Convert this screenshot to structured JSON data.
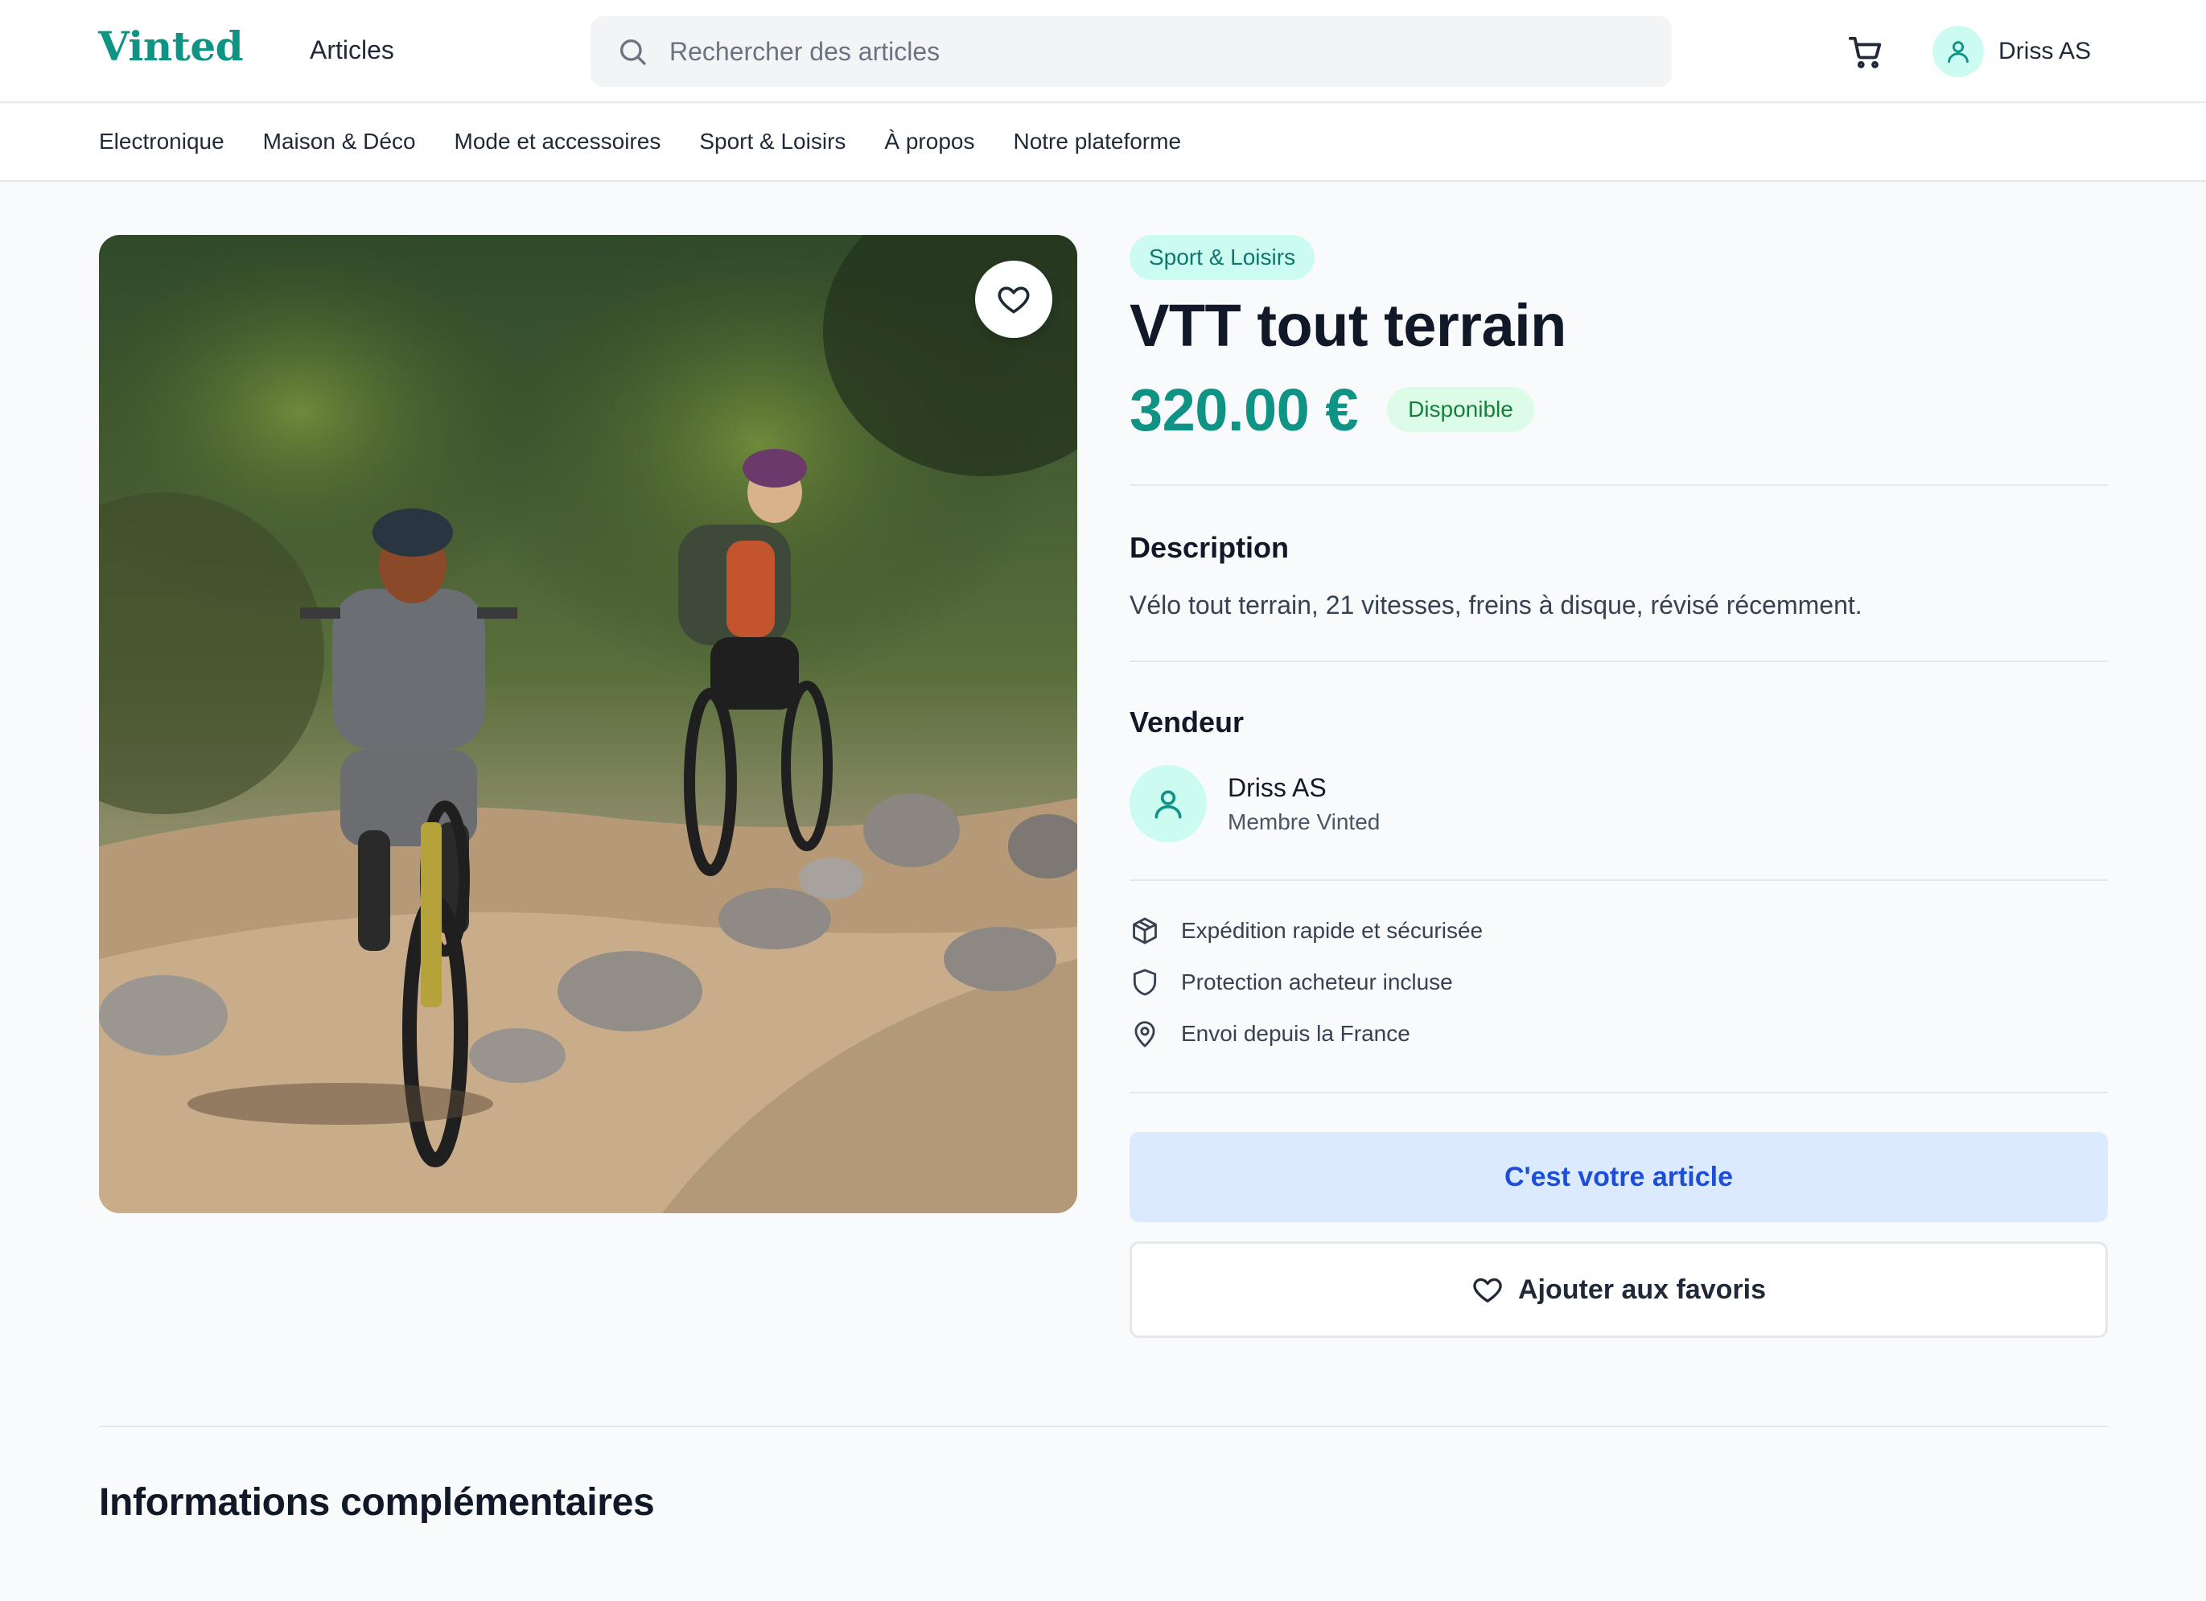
{
  "header": {
    "logo": "Vinted",
    "nav_articles": "Articles",
    "search_placeholder": "Rechercher des articles",
    "user_name": "Driss AS",
    "icons": {
      "search": "search-icon",
      "cart": "cart-icon",
      "user": "user-icon"
    }
  },
  "categories": [
    "Electronique",
    "Maison & Déco",
    "Mode et accessoires",
    "Sport & Loisirs",
    "À propos",
    "Notre plateforme"
  ],
  "product": {
    "category": "Sport & Loisirs",
    "title": "VTT tout terrain",
    "price": "320.00 €",
    "status": "Disponible",
    "description_heading": "Description",
    "description": "Vélo tout terrain, 21 vitesses, freins à disque, révisé récemment."
  },
  "seller": {
    "heading": "Vendeur",
    "name": "Driss AS",
    "role": "Membre Vinted"
  },
  "features": [
    {
      "icon": "package-icon",
      "label": "Expédition rapide et sécurisée"
    },
    {
      "icon": "shield-icon",
      "label": "Protection acheteur incluse"
    },
    {
      "icon": "map-pin-icon",
      "label": "Envoi depuis la France"
    }
  ],
  "actions": {
    "own_article": "C'est votre article",
    "add_favorite": "Ajouter aux favoris"
  },
  "more_info_heading": "Informations complémentaires",
  "colors": {
    "brand": "#0e9384",
    "badge_bg": "#ccfbf1",
    "status_bg": "#dcfce7",
    "status_text": "#15803d",
    "own_btn_bg": "#dbeafe",
    "own_btn_text": "#1d4ed8"
  }
}
